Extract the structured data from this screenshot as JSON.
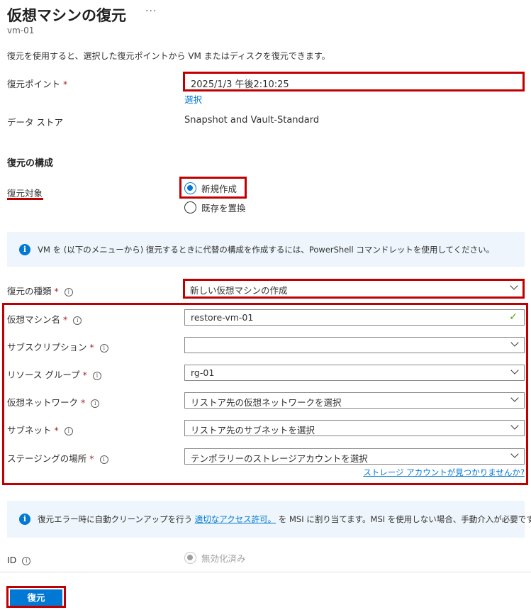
{
  "header": {
    "title": "仮想マシンの復元",
    "more": "···",
    "subtitle": "vm-01"
  },
  "description": "復元を使用すると、選択した復元ポイントから VM またはディスクを復元できます。",
  "restore_point": {
    "label": "復元ポイント",
    "value": "2025/1/3 午後2:10:25",
    "select_link": "選択"
  },
  "data_store": {
    "label": "データ ストア",
    "value": "Snapshot and Vault-Standard"
  },
  "config": {
    "section_title": "復元の構成",
    "target_label": "復元対象",
    "options": [
      {
        "label": "新規作成",
        "selected": true
      },
      {
        "label": "既存を置換",
        "selected": false
      }
    ]
  },
  "info1": "VM を (以下のメニューから) 復元するときに代替の構成を作成するには、PowerShell コマンドレットを使用してください。",
  "restore_type": {
    "label": "復元の種類",
    "value": "新しい仮想マシンの作成"
  },
  "fields": {
    "vm_name": {
      "label": "仮想マシン名",
      "value": "restore-vm-01"
    },
    "subscription": {
      "label": "サブスクリプション",
      "value": ""
    },
    "resource_group": {
      "label": "リソース グループ",
      "value": "rg-01"
    },
    "vnet": {
      "label": "仮想ネットワーク",
      "value": "リストア先の仮想ネットワークを選択"
    },
    "subnet": {
      "label": "サブネット",
      "value": "リストア先のサブネットを選択"
    },
    "staging": {
      "label": "ステージングの場所",
      "value": "テンポラリーのストレージアカウントを選択"
    }
  },
  "storage_link": "ストレージ アカウントが見つかりませんか?",
  "info2": {
    "prefix": "復元エラー時に自動クリーンアップを行う ",
    "link": "適切なアクセス許可。",
    "suffix": " を MSI に割り当てます。MSI を使用しない場合、手動介入が必要です。"
  },
  "identity": {
    "label": "ID",
    "option": "無効化済み"
  },
  "restore_button": "復元",
  "required_mark": "*",
  "info_glyph": "i",
  "colors": {
    "accent": "#0078d4",
    "highlight": "#c00000",
    "info_bg": "#eef5fc"
  }
}
